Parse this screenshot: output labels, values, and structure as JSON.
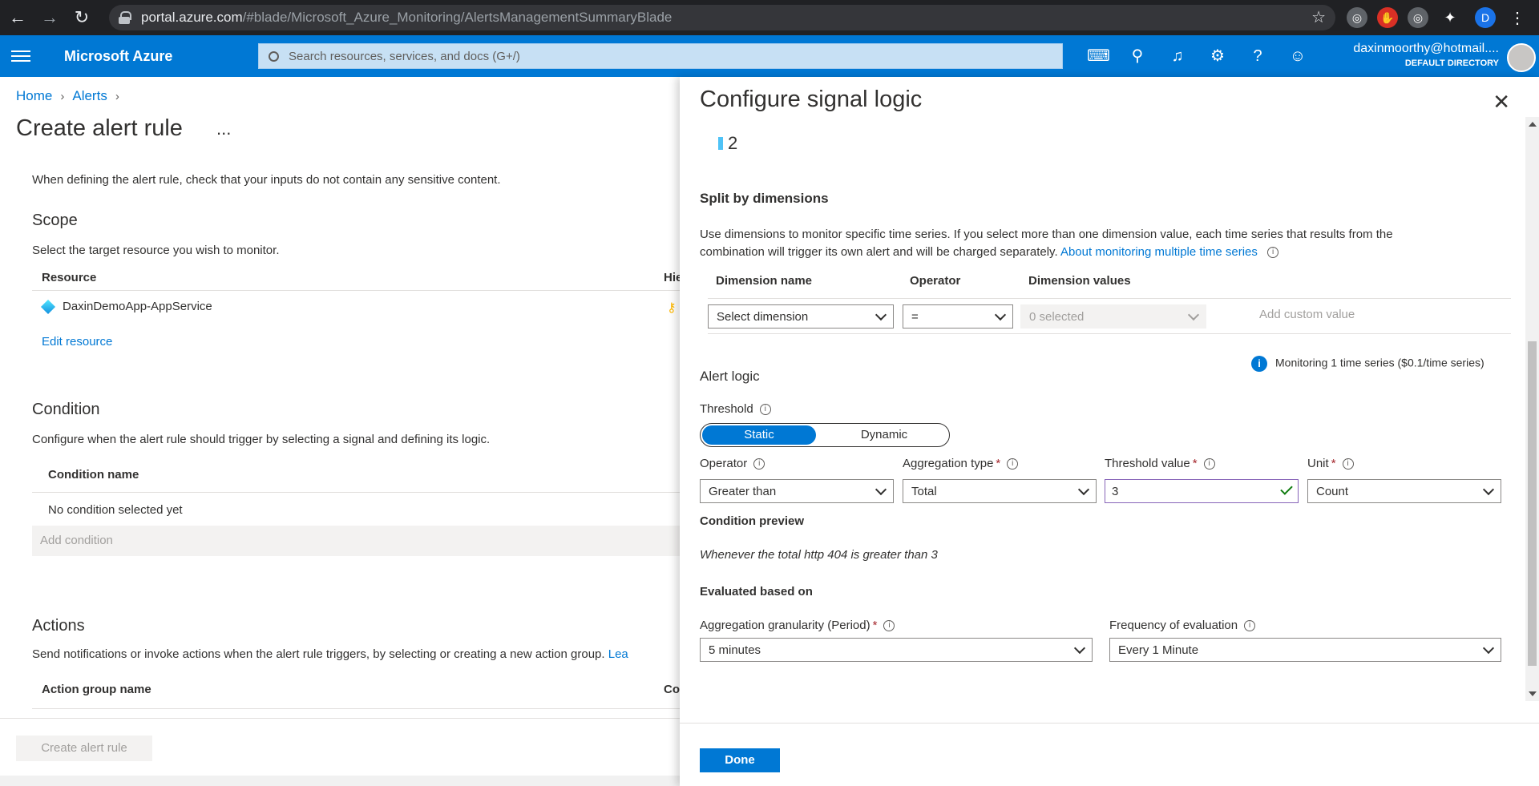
{
  "browser": {
    "url_host": "portal.azure.com",
    "url_path": "/#blade/Microsoft_Azure_Monitoring/AlertsManagementSummaryBlade",
    "profile_initial": "D"
  },
  "topbar": {
    "brand": "Microsoft Azure",
    "search_placeholder": "Search resources, services, and docs (G+/)",
    "user_email": "daxinmoorthy@hotmail....",
    "user_directory": "DEFAULT DIRECTORY"
  },
  "breadcrumb": [
    "Home",
    "Alerts"
  ],
  "page": {
    "title": "Create alert rule",
    "more": "...",
    "notice": "When defining the alert rule, check that your inputs do not contain any sensitive content.",
    "scope": {
      "heading": "Scope",
      "desc": "Select the target resource you wish to monitor.",
      "col_resource": "Resource",
      "col_hierarchy": "Hie",
      "resource_name": "DaxinDemoApp-AppService",
      "edit_link": "Edit resource"
    },
    "condition": {
      "heading": "Condition",
      "desc": "Configure when the alert rule should trigger by selecting a signal and defining its logic.",
      "col_name": "Condition name",
      "empty": "No condition selected yet",
      "add_button": "Add condition"
    },
    "actions": {
      "heading": "Actions",
      "desc": "Send notifications or invoke actions when the alert rule triggers, by selecting or creating a new action group.",
      "desc_link": "Lea",
      "col_name": "Action group name",
      "col_co": "Co"
    },
    "create_button": "Create alert rule"
  },
  "panel": {
    "title": "Configure signal logic",
    "chart_value_fragment": "2",
    "split": {
      "heading": "Split by dimensions",
      "desc": "Use dimensions to monitor specific time series. If you select more than one dimension value, each time series that results from the combination will trigger its own alert and will be charged separately.",
      "desc_link": "About monitoring multiple time series",
      "col_dimension": "Dimension name",
      "col_operator": "Operator",
      "col_values": "Dimension values",
      "dimension_value": "Select dimension",
      "operator_value": "=",
      "values_value": "0 selected",
      "custom_placeholder": "Add custom value"
    },
    "monitoring_note": "Monitoring 1 time series ($0.1/time series)",
    "alert_logic": {
      "heading": "Alert logic",
      "threshold_label": "Threshold",
      "threshold_static": "Static",
      "threshold_dynamic": "Dynamic",
      "operator_label": "Operator",
      "operator_value": "Greater than",
      "aggregation_label": "Aggregation type",
      "aggregation_value": "Total",
      "threshold_value_label": "Threshold value",
      "threshold_value": "3",
      "unit_label": "Unit",
      "unit_value": "Count",
      "preview_heading": "Condition preview",
      "preview_text": "Whenever the total http 404 is greater than 3"
    },
    "evaluation": {
      "heading": "Evaluated based on",
      "granularity_label": "Aggregation granularity (Period)",
      "granularity_value": "5 minutes",
      "frequency_label": "Frequency of evaluation",
      "frequency_value": "Every 1 Minute"
    },
    "done_button": "Done"
  }
}
